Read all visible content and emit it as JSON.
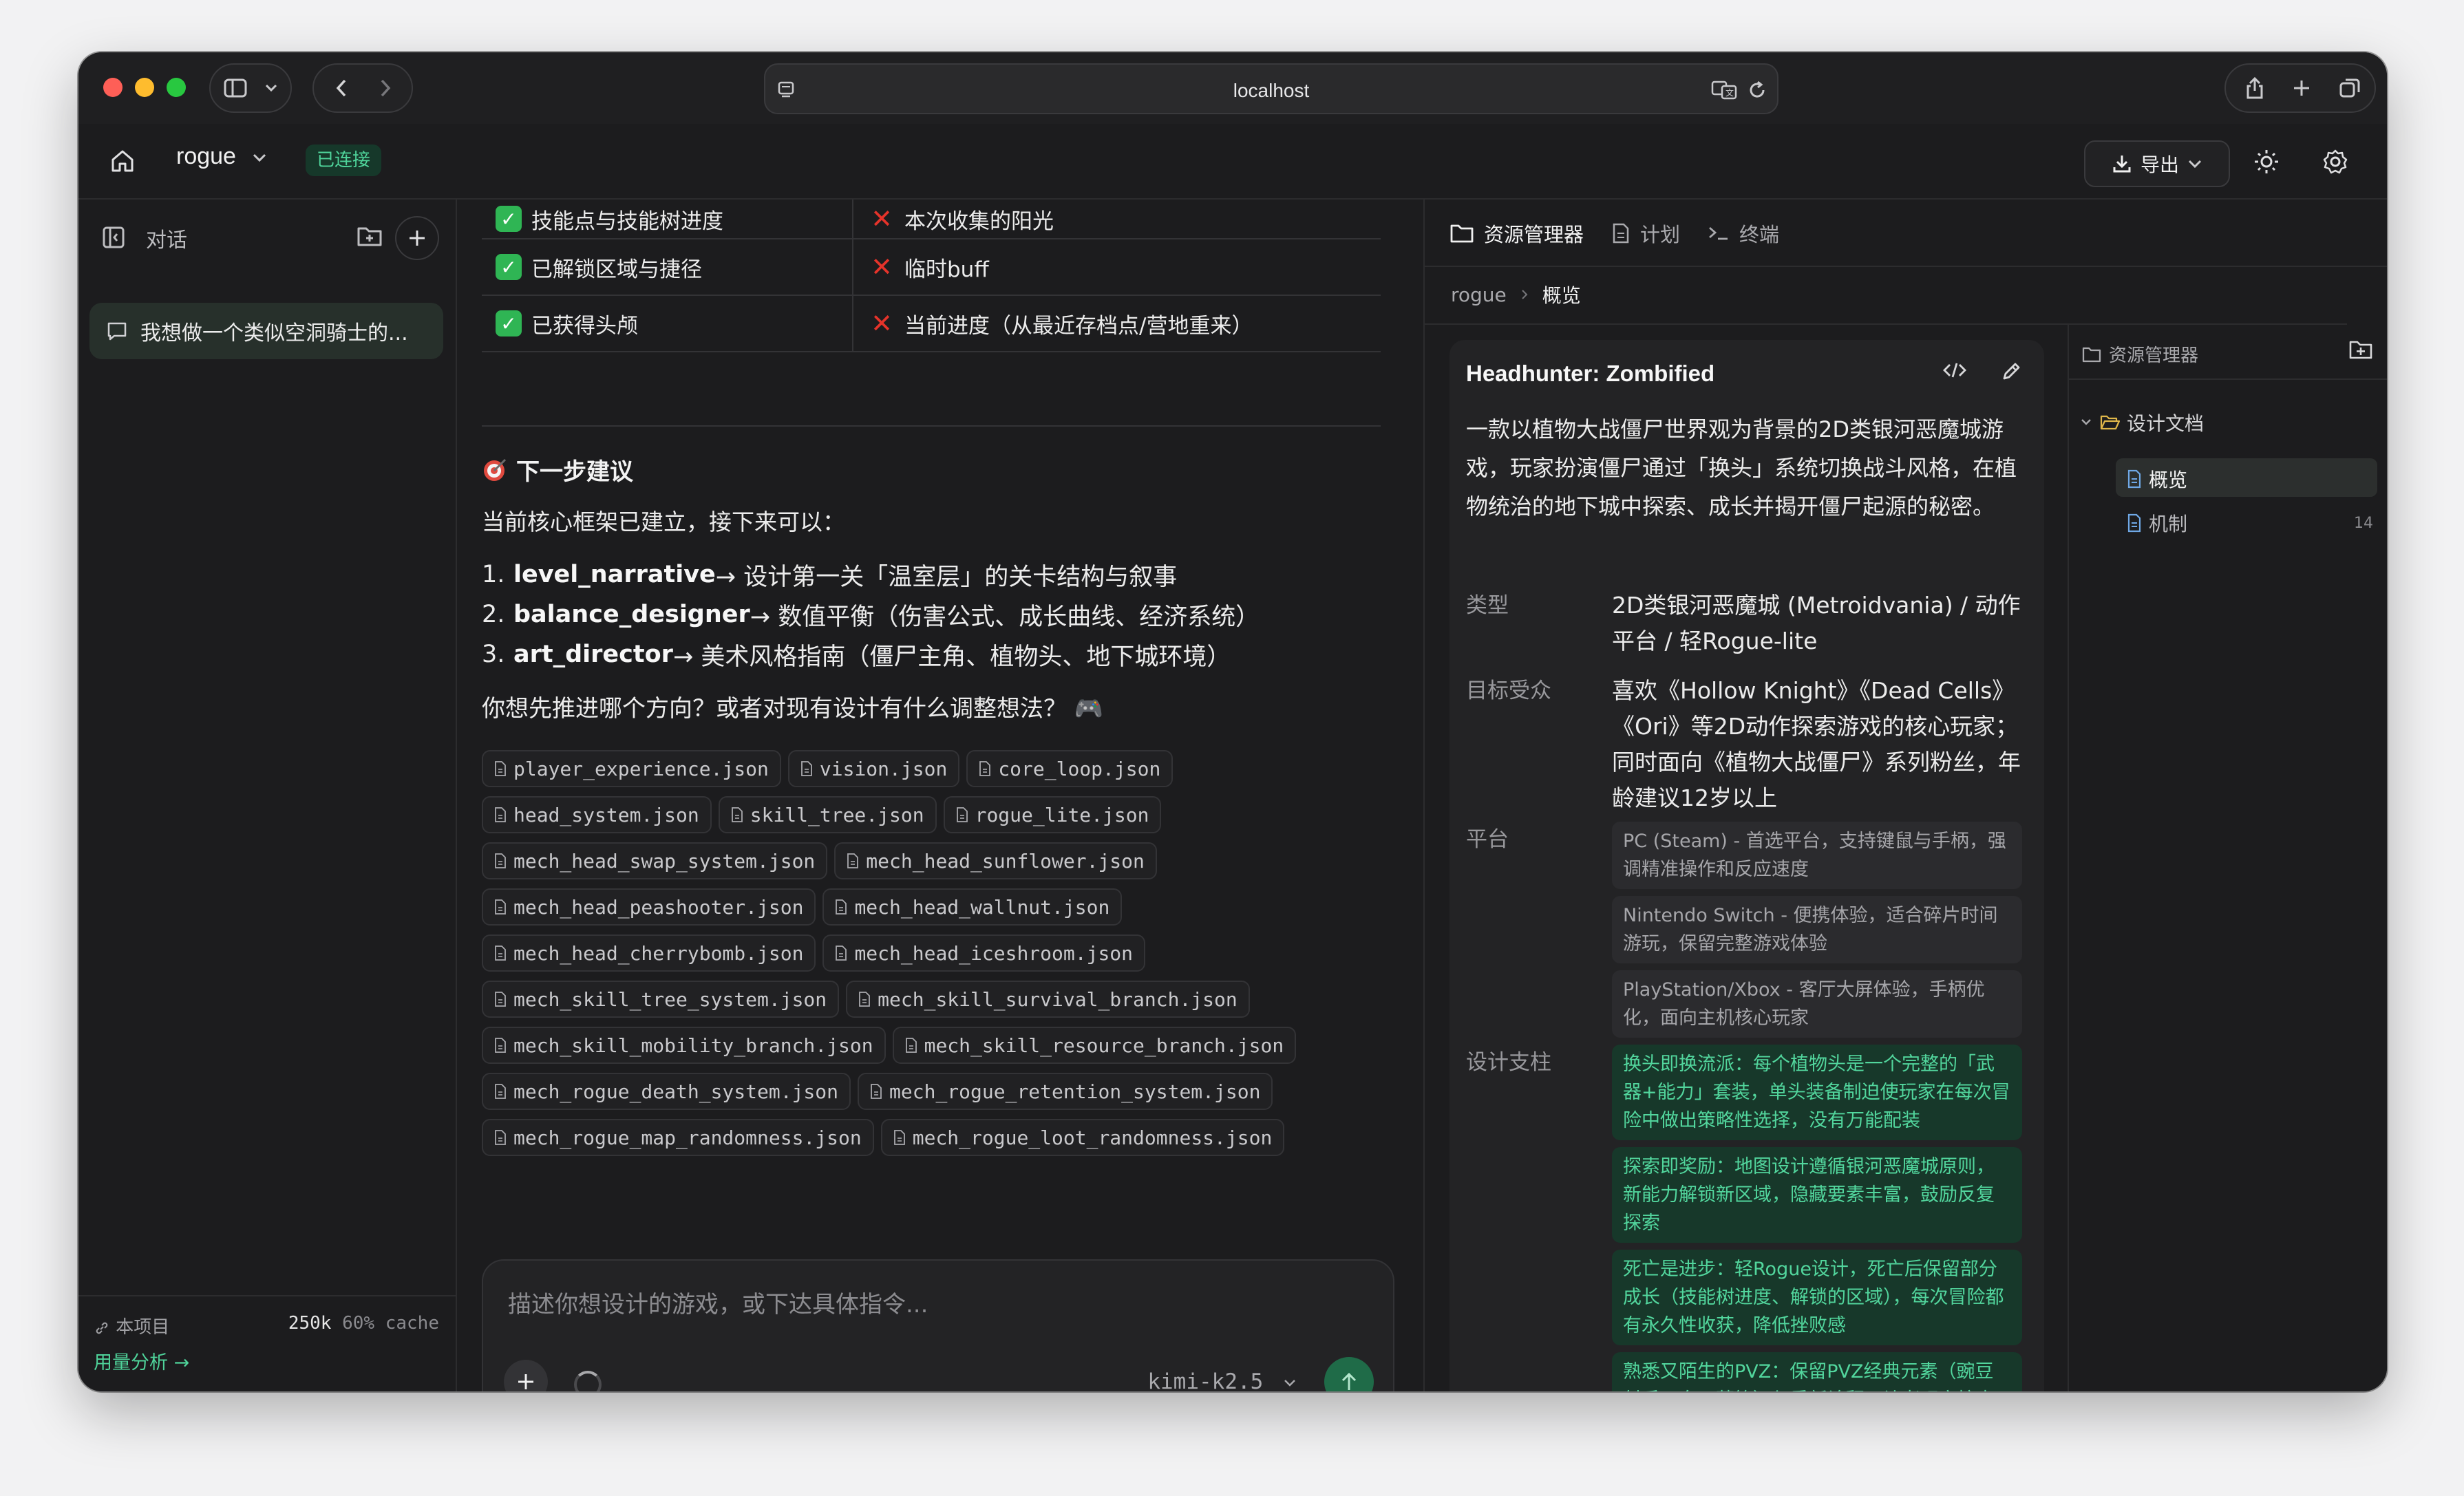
{
  "browser": {
    "url": "localhost"
  },
  "header": {
    "project": "rogue",
    "status": "已连接",
    "export_label": "导出"
  },
  "sidebar": {
    "title": "对话",
    "conversations": [
      "我想做一个类似空洞骑士的..."
    ],
    "footer": {
      "project_label": "本项目",
      "tokens": "250k",
      "cache": "60% cache",
      "usage_link": "用量分析 →"
    }
  },
  "chat": {
    "table": [
      {
        "ok": "技能点与技能树进度",
        "lost": "本次收集的阳光"
      },
      {
        "ok": "已解锁区域与捷径",
        "lost": "临时buff"
      },
      {
        "ok": "已获得头颅",
        "lost": "当前进度（从最近存档点/营地重来）"
      }
    ],
    "next_heading": "下一步建议",
    "intro": "当前核心框架已建立，接下来可以：",
    "suggestions": [
      {
        "num": "1.",
        "key": "level_narrative",
        "text": " → 设计第一关「温室层」的关卡结构与叙事"
      },
      {
        "num": "2.",
        "key": "balance_designer",
        "text": " → 数值平衡（伤害公式、成长曲线、经济系统）"
      },
      {
        "num": "3.",
        "key": "art_director",
        "text": " → 美术风格指南（僵尸主角、植物头、地下城环境）"
      }
    ],
    "ask": "你想先推进哪个方向？或者对现有设计有什么调整想法？ 🎮",
    "files": [
      [
        "player_experience.json",
        "vision.json",
        "core_loop.json"
      ],
      [
        "head_system.json",
        "skill_tree.json",
        "rogue_lite.json"
      ],
      [
        "mech_head_swap_system.json",
        "mech_head_sunflower.json"
      ],
      [
        "mech_head_peashooter.json",
        "mech_head_wallnut.json"
      ],
      [
        "mech_head_cherrybomb.json",
        "mech_head_iceshroom.json"
      ],
      [
        "mech_skill_tree_system.json",
        "mech_skill_survival_branch.json"
      ],
      [
        "mech_skill_mobility_branch.json",
        "mech_skill_resource_branch.json"
      ],
      [
        "mech_rogue_death_system.json",
        "mech_rogue_retention_system.json"
      ],
      [
        "mech_rogue_map_randomness.json",
        "mech_rogue_loot_randomness.json"
      ]
    ],
    "composer": {
      "placeholder": "描述你想设计的游戏，或下达具体指令...",
      "model": "kimi-k2.5"
    }
  },
  "panel": {
    "tabs": [
      "资源管理器",
      "计划",
      "终端"
    ],
    "breadcrumb": [
      "rogue",
      "概览"
    ],
    "card": {
      "title": "Headhunter: Zombified",
      "description": "一款以植物大战僵尸世界观为背景的2D类银河恶魔城游戏，玩家扮演僵尸通过「换头」系统切换战斗风格，在植物统治的地下城中探索、成长并揭开僵尸起源的秘密。",
      "genre_label": "类型",
      "genre": "2D类银河恶魔城 (Metroidvania) / 动作平台 / 轻Rogue-lite",
      "audience_label": "目标受众",
      "audience": "喜欢《Hollow Knight》《Dead Cells》《Ori》等2D动作探索游戏的核心玩家；同时面向《植物大战僵尸》系列粉丝，年龄建议12岁以上",
      "platform_label": "平台",
      "platforms": [
        "PC (Steam) - 首选平台，支持键鼠与手柄，强调精准操作和反应速度",
        "Nintendo Switch - 便携体验，适合碎片时间游玩，保留完整游戏体验",
        "PlayStation/Xbox - 客厅大屏体验，手柄优化，面向主机核心玩家"
      ],
      "pillars_label": "设计支柱",
      "pillars": [
        "换头即换流派：每个植物头是一个完整的「武器+能力」套装，单头装备制迫使玩家在每次冒险中做出策略性选择，没有万能配装",
        "探索即奖励：地图设计遵循银河恶魔城原则，新能力解锁新区域，隐藏要素丰富，鼓励反复探索",
        "死亡是进步：轻Rogue设计，死亡后保留部分成长（技能树进度、解锁的区域），每次冒险都有永久性收获，降低挫败感",
        "熟悉又陌生的PVZ：保留PVZ经典元素（豌豆射手、向日葵等）但重新诠释，让老玩家惊喜"
      ]
    },
    "tree": {
      "title": "资源管理器",
      "folder": "设计文档",
      "items": [
        {
          "name": "概览",
          "count": ""
        },
        {
          "name": "机制",
          "count": "14"
        }
      ]
    }
  },
  "colors": {
    "accent": "#4fd39a",
    "check": "#2fb554",
    "cross": "#e5332a",
    "send": "#1f6b48"
  }
}
